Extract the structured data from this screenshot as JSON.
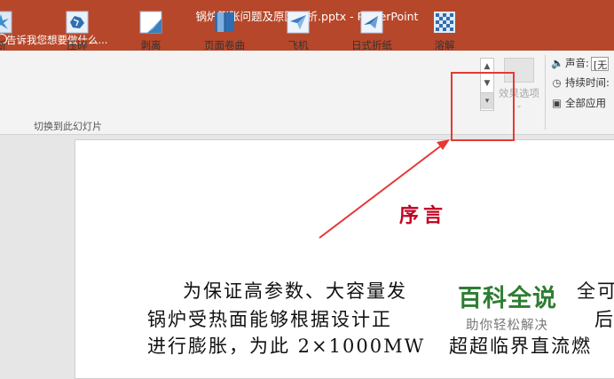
{
  "window": {
    "title": "锅炉膨胀问题及原因分析.pptx - PowerPoint"
  },
  "tell_me": {
    "placeholder": "告诉我您想要做什么..."
  },
  "transitions": [
    {
      "label": "断",
      "icon": "shatter-icon",
      "color": "#3a8fcf"
    },
    {
      "label": "压碎",
      "icon": "crush-icon",
      "color": "#2f6eb0"
    },
    {
      "label": "剥离",
      "icon": "peel-off-icon",
      "color": "#3a7fbf"
    },
    {
      "label": "页面卷曲",
      "icon": "page-curl-icon",
      "color": "#2f6eb0"
    },
    {
      "label": "飞机",
      "icon": "airplane-icon",
      "color": "#3a7fbf"
    },
    {
      "label": "日式折纸",
      "icon": "origami-icon",
      "color": "#2f6eb0"
    },
    {
      "label": "溶解",
      "icon": "dissolve-icon",
      "color": "#2f6eb0"
    }
  ],
  "ribbon": {
    "effect_options": "效果选项",
    "group_label": "切换到此幻灯片",
    "scroll_up": "▲",
    "scroll_down": "▼",
    "scroll_more": "▾"
  },
  "timing": {
    "sound_label": "声音:",
    "sound_value": "[无",
    "duration_label": "持续时间:",
    "apply_all": "全部应用"
  },
  "slide": {
    "title": "序言",
    "lines": [
      "为保证高参数、大容量发",
      "锅炉受热面能够根据设计正",
      "进行膨胀，为此 2×1000MW",
      "超超临界直流燃"
    ],
    "right_fragments": [
      "全可",
      "后",
      ""
    ]
  },
  "watermark": {
    "title": "百科全说",
    "subtitle": "助你轻松解决"
  },
  "colors": {
    "brand": "#b7472a",
    "annotation": "#e53935",
    "slide_title": "#c0001f",
    "watermark": "#2e7d32"
  }
}
